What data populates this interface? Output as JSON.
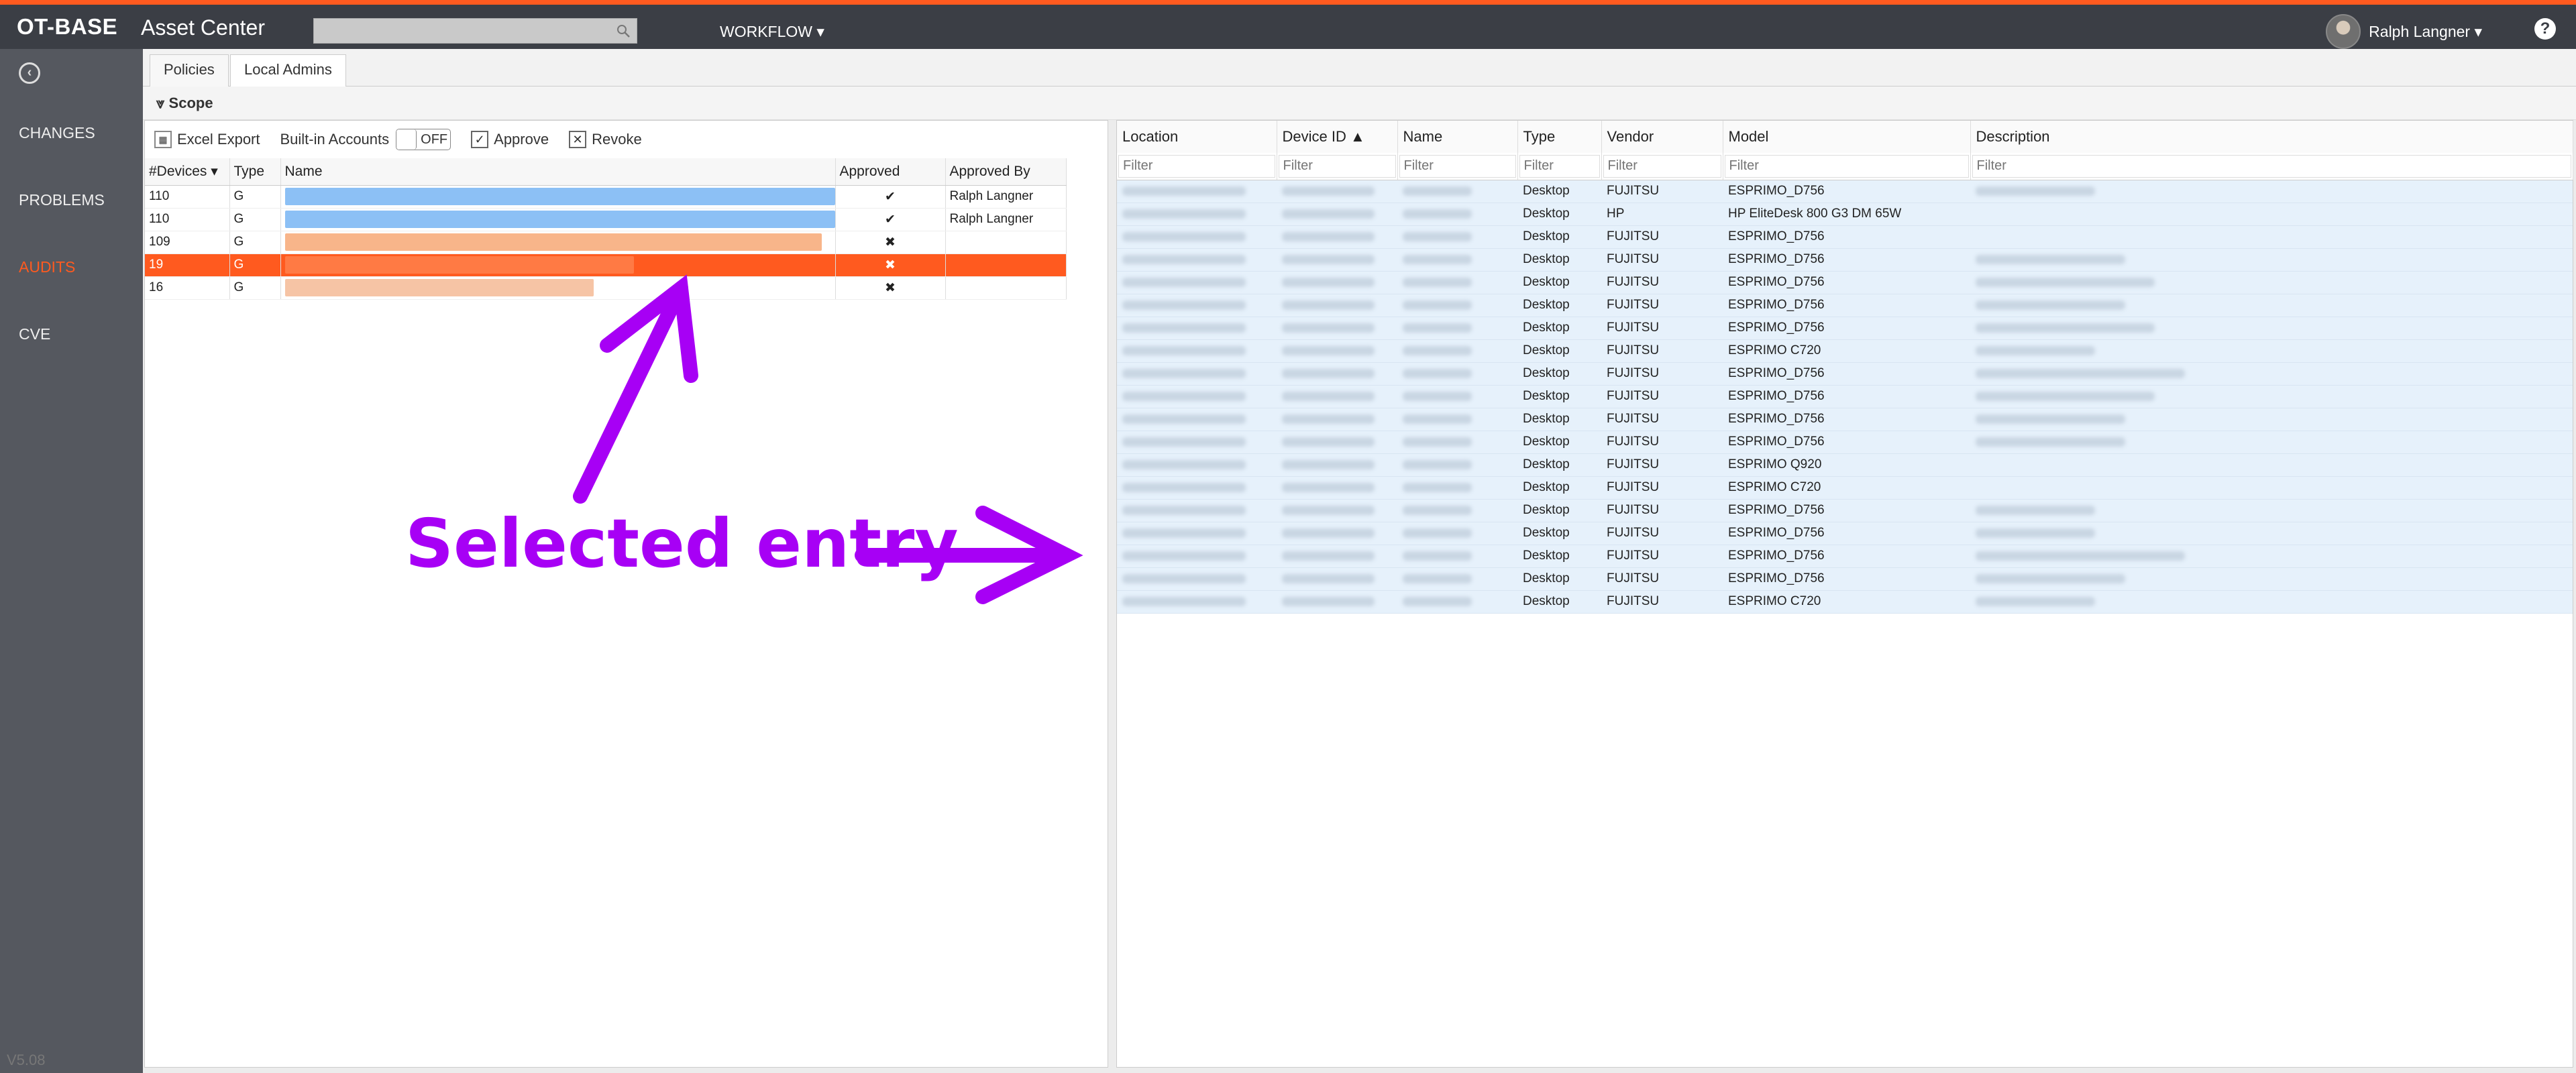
{
  "header": {
    "brand": "OT-BASE",
    "app_name": "Asset Center",
    "search_placeholder": "",
    "workflow_label": "WORKFLOW ▾",
    "user_name": "Ralph Langner ▾",
    "help": "?"
  },
  "sidebar": {
    "back": "‹",
    "items": [
      {
        "label": "CHANGES",
        "active": false
      },
      {
        "label": "PROBLEMS",
        "active": false
      },
      {
        "label": "AUDITS",
        "active": true
      },
      {
        "label": "CVE",
        "active": false
      }
    ],
    "version": "V5.08"
  },
  "tabs": [
    {
      "label": "Policies",
      "active": false
    },
    {
      "label": "Local Admins",
      "active": true
    }
  ],
  "scope": {
    "label": "Scope"
  },
  "left_toolbar": {
    "excel_export": "Excel Export",
    "builtin_accounts": "Built-in Accounts",
    "toggle_state": "OFF",
    "approve": "Approve",
    "revoke": "Revoke"
  },
  "left_table": {
    "columns": [
      "#Devices ▾",
      "Type",
      "Name",
      "Approved",
      "Approved By"
    ],
    "rows": [
      {
        "devices": "110",
        "type": "G",
        "approved": "✔",
        "approved_by": "Ralph Langner",
        "bar_color": "#8cc0f5",
        "selected": false
      },
      {
        "devices": "110",
        "type": "G",
        "approved": "✔",
        "approved_by": "Ralph Langner",
        "bar_color": "#8cc0f5",
        "selected": false
      },
      {
        "devices": "109",
        "type": "G",
        "approved": "✖",
        "approved_by": "",
        "bar_color": "#f8b58a",
        "selected": false
      },
      {
        "devices": "19",
        "type": "G",
        "approved": "✖",
        "approved_by": "",
        "bar_color": "#ff7a44",
        "selected": true
      },
      {
        "devices": "16",
        "type": "G",
        "approved": "✖",
        "approved_by": "",
        "bar_color": "#f6c4a5",
        "selected": false
      }
    ]
  },
  "right_table": {
    "columns": [
      "Location",
      "Device ID ▲",
      "Name",
      "Type",
      "Vendor",
      "Model",
      "Description"
    ],
    "filter_placeholder": "Filter",
    "rows": [
      {
        "type": "Desktop",
        "vendor": "FUJITSU",
        "model": "ESPRIMO_D756"
      },
      {
        "type": "Desktop",
        "vendor": "HP",
        "model": "HP EliteDesk 800 G3 DM 65W"
      },
      {
        "type": "Desktop",
        "vendor": "FUJITSU",
        "model": "ESPRIMO_D756"
      },
      {
        "type": "Desktop",
        "vendor": "FUJITSU",
        "model": "ESPRIMO_D756"
      },
      {
        "type": "Desktop",
        "vendor": "FUJITSU",
        "model": "ESPRIMO_D756"
      },
      {
        "type": "Desktop",
        "vendor": "FUJITSU",
        "model": "ESPRIMO_D756"
      },
      {
        "type": "Desktop",
        "vendor": "FUJITSU",
        "model": "ESPRIMO_D756"
      },
      {
        "type": "Desktop",
        "vendor": "FUJITSU",
        "model": "ESPRIMO C720"
      },
      {
        "type": "Desktop",
        "vendor": "FUJITSU",
        "model": "ESPRIMO_D756"
      },
      {
        "type": "Desktop",
        "vendor": "FUJITSU",
        "model": "ESPRIMO_D756"
      },
      {
        "type": "Desktop",
        "vendor": "FUJITSU",
        "model": "ESPRIMO_D756"
      },
      {
        "type": "Desktop",
        "vendor": "FUJITSU",
        "model": "ESPRIMO_D756"
      },
      {
        "type": "Desktop",
        "vendor": "FUJITSU",
        "model": "ESPRIMO Q920"
      },
      {
        "type": "Desktop",
        "vendor": "FUJITSU",
        "model": "ESPRIMO C720"
      },
      {
        "type": "Desktop",
        "vendor": "FUJITSU",
        "model": "ESPRIMO_D756"
      },
      {
        "type": "Desktop",
        "vendor": "FUJITSU",
        "model": "ESPRIMO_D756"
      },
      {
        "type": "Desktop",
        "vendor": "FUJITSU",
        "model": "ESPRIMO_D756"
      },
      {
        "type": "Desktop",
        "vendor": "FUJITSU",
        "model": "ESPRIMO_D756"
      },
      {
        "type": "Desktop",
        "vendor": "FUJITSU",
        "model": "ESPRIMO C720"
      }
    ]
  },
  "annotation": {
    "text": "Selected entry",
    "color": "#a700f5"
  },
  "colors": {
    "accent": "#ff5a1f",
    "topbar": "#3b3e45",
    "sidebar": "#55585f",
    "row_highlight": "#e6f1fb"
  }
}
